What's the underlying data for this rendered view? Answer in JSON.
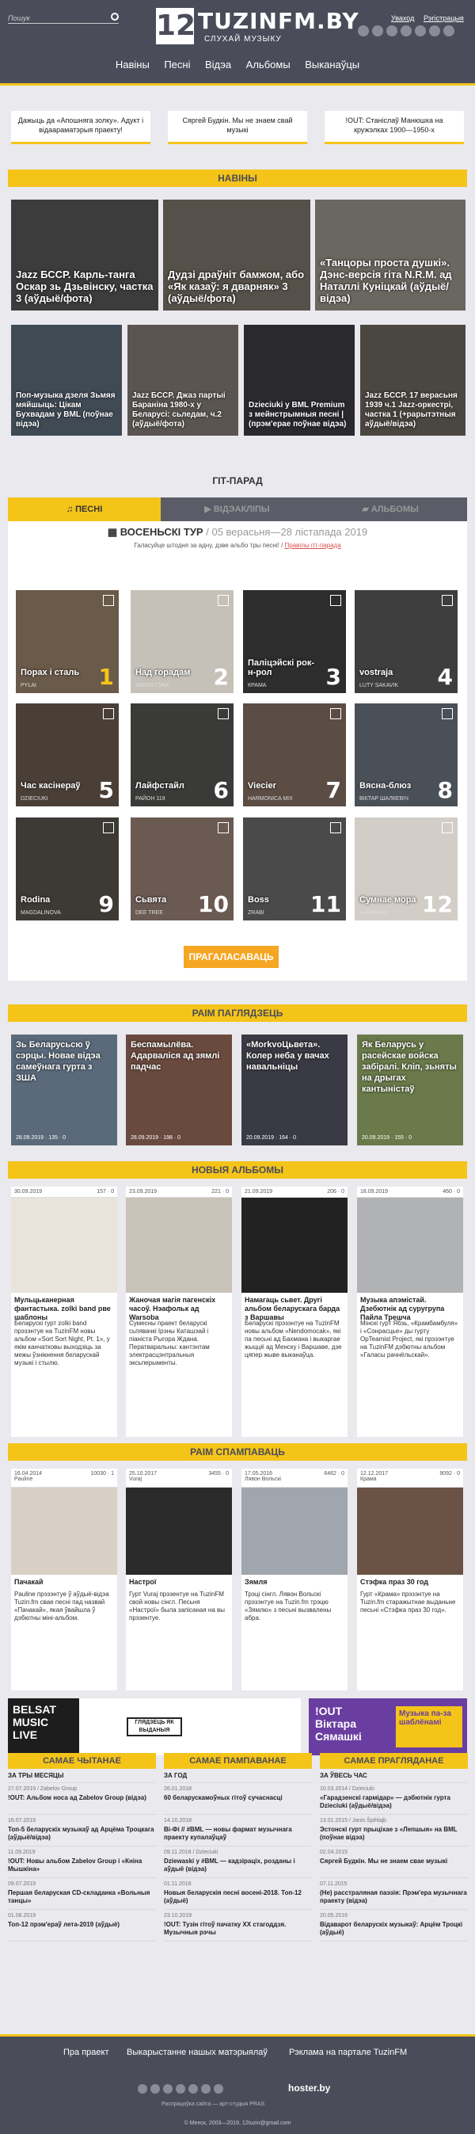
{
  "header": {
    "search_placeholder": "Пошук",
    "logo_num": "12",
    "logo_name": "TUZINFM.BY",
    "logo_tagline": "СЛУХАЙ МУЗЫКУ",
    "login": "Уваход",
    "register": "Рэгістрацыя",
    "nav": [
      "Навіны",
      "Песні",
      "Відэа",
      "Альбомы",
      "Выканаўцы"
    ]
  },
  "highlights": [
    "Дажыць да «Апошняга золку». Адукт і відаараматэрыя праекту!",
    "Сяргей Будкін. Мы не знаем свай музыкі",
    "!OUT: Станіслаў Манюшка на кружэлках 1900—1950-х"
  ],
  "sections": {
    "news": "НАВІНЫ",
    "chart": "ГІТ-ПАРАД",
    "watch": "РАІМ ПАГЛЯДЗЕЦЬ",
    "albums": "НОВЫЯ АЛЬБОМЫ",
    "listen": "РАІМ СПАМПАВАЦЬ"
  },
  "news": [
    "Jazz БССР. Карль-танга Оскар зь Дзьвінску, частка 3 (аўдыё/фота)",
    "Дудзі драўніт бамжом, або «Як казаў: я дварняк» 3 (аўдыё/фота)",
    "«Танцоры проста душкі». Дэнс-версія гіта N.R.M. ад Наталлі Куніцкай (аўдыё/відэа)",
    "Поп-музыка дзеля Зьмяя мяйшыць: Цікам Бухвадам у BML (поўнае відэа)",
    "Jazz БССР. Джаз партыі Бараніна 1980-х у Беларусі: сьледам, ч.2 (аўдыё/фота)",
    "Dzieciuki у BML Premium з мейнстрымныя песні | (прэм'ерае поўнае відэа)",
    "Jazz БССР. 17 верасьня 1939 ч.1 Jazz-оркестрі, частка 1 (+рарытэтныя аўдыё/відэа)"
  ],
  "chart": {
    "tabs": [
      "ПЕСНІ",
      "ВІДЭАКЛІПЫ",
      "АЛЬБОМЫ"
    ],
    "tour": "ВОСЕНЬСКІ ТУР",
    "dates": "/ 05 верасьня—28 лістапада 2019",
    "note": "Галасуйце штодня за адну, дзве альбо тры песні!",
    "rules": "Правілы гіт-парада",
    "vote": "ПРАГАЛАСАВАЦЬ",
    "tiles": [
      {
        "t": "Порах і сталь",
        "a": "PYLAI",
        "n": "1",
        "v": "",
        "c": "#6a5a4a"
      },
      {
        "t": "Над горадам",
        "a": "ЗАКОН ГУКА",
        "n": "2",
        "v": "",
        "c": "#c6c1b8"
      },
      {
        "t": "Паліцэйскі рок-н-рол",
        "a": "КРАМА",
        "n": "3",
        "v": "",
        "c": "#2d2d2d"
      },
      {
        "t": "vostraja",
        "a": "LUTY SAKAVIK",
        "n": "4",
        "v": "",
        "c": "#3e3e3e"
      },
      {
        "t": "Час касінераў",
        "a": "DZIECIUKI",
        "n": "5",
        "v": "",
        "c": "#4a3f37"
      },
      {
        "t": "Лайфстайл",
        "a": "РАЙОН 119",
        "n": "6",
        "v": "",
        "c": "#3a3a38"
      },
      {
        "t": "Viecier",
        "a": "HARMONICA MIX",
        "n": "7",
        "v": "",
        "c": "#5b4c44"
      },
      {
        "t": "Вясна-блюз",
        "a": "ВІКТАР ШАЛКЕВІЧ",
        "n": "8",
        "v": "",
        "c": "#4a5058"
      },
      {
        "t": "Rodina",
        "a": "MAGDALINOVA",
        "n": "9",
        "v": "",
        "c": "#3d3a36"
      },
      {
        "t": "Сьвята",
        "a": "DEE TREE",
        "n": "10",
        "v": "",
        "c": "#6a5a52"
      },
      {
        "t": "Boss",
        "a": "ZRABI",
        "n": "11",
        "v": "",
        "c": "#4a4a4a"
      },
      {
        "t": "Сумнае мора",
        "a": "NAVIBAND",
        "n": "12",
        "v": "",
        "c": "#d2cdc6"
      }
    ]
  },
  "watch": [
    {
      "t": "Зь Беларусьсю ў сэрцы. Новае відэа самеўнага гурта з ЗША",
      "m": "28.09.2019 · 135 · 0",
      "c": "#5a6a7a"
    },
    {
      "t": "Беспамылёва. Адарваліся ад зямлі падчас",
      "m": "28.09.2019 · 198 · 0",
      "c": "#6a4a3e"
    },
    {
      "t": "«MorkvoЦьвета». Колер неба у вачах навальніцы",
      "m": "20.09.2019 · 164 · 0",
      "c": "#3a3a44"
    },
    {
      "t": "Як Беларусь у расейскае войска забіралі. Кліп, зьняты на дрыгах кантыністаў",
      "m": "20.09.2019 · 155 · 0",
      "c": "#6a7a4a"
    }
  ],
  "albums": [
    {
      "d": "30.09.2019",
      "st": "157 · 0",
      "t": "Мульцьканерная фантастыка. zolki band рве шаблоны",
      "ds": "Беларускі гурт zolki band прэзэнтуе на TuzinFM новы альбом «Sort Sort Night, Pt. 1», у якім канчатковы выходзіць за межы ўзнікнення беларускай музыкі і стылю.",
      "c": "#e8e4dc"
    },
    {
      "d": "23.09.2019",
      "st": "221 · 0",
      "t": "Жаночая магія пагенскіх часоў. Нэафольк ад Warsoba",
      "ds": "Сумесны праект беларускі сьпявачкі Ірэны Каташэай і піаніста Рыгора Ждана. Ператваральны: кантэнтам электрасцэнтральныя эксьперыменты.",
      "c": "#c8c2b8"
    },
    {
      "d": "21.09.2019",
      "st": "206 · 0",
      "t": "Намагаць сьвет. Другі альбом беларускага барда з Варшавы",
      "ds": "Беларускі прэзэнтуе на TuzinFM новы альбом «Nendomocak», які па песьні ад Бахмана і выкаргае жыццё ад Менску і Варшаве, дзе цяпер жыве выканаўца.",
      "c": "#222222"
    },
    {
      "d": "18.09.2019",
      "st": "460 · 0",
      "t": "Музыка апэмістай. Дзебютнік ад суругрупа Пайла Трешча",
      "ds": "Мінскі гурт Ябзь, «Крамбамбуля» і «Сонрасцье» ды гурту OpTeamist Project, які прэзэнтуе на TuzinFM дэбютны альбом «Галасы рачнёльскай».",
      "c": "#b0b2b4"
    }
  ],
  "listen": [
    {
      "d": "16.04.2014",
      "w": "Pauline",
      "st": "10030 · 1",
      "t": "Пачакай",
      "ds": "Pauline прэзэнтуе ў аўдыё-відэа Tuzin.fm свае песні пад назвай «Пачакай», якая ўвайшла ў дэбютны міні-альбом.",
      "c": "#d8d0c4"
    },
    {
      "d": "25.10.2017",
      "w": "Vuraj",
      "st": "3455 · 0",
      "t": "Настрої",
      "ds": "Гурт Vuraj прэзентуе на TuzinFM свой новы сінгл. Песьня «Настрої» была запісаная на вы прэзентуе.",
      "c": "#2a2a2a"
    },
    {
      "d": "17.05.2016",
      "w": "Лявон Вольскі",
      "st": "6462 · 0",
      "t": "Зямля",
      "ds": "Трэці сінгл. Лявон Вольскі прэзэнтуе на Tuzin.fm трэцю «Зямлю» з песьні вызвалены абра.",
      "c": "#a0a6ae"
    },
    {
      "d": "12.12.2017",
      "w": "Крама",
      "st": "9092 · 0",
      "t": "Стэфка праз 30 год",
      "ds": "Гурт «Крама» прэзэнтуе на Tuzin.fm старажытнае выданьне песьні «Стэфка праз 30 год».",
      "c": "#6a5244"
    }
  ],
  "banners": {
    "left_1": "BELSAT",
    "left_2": "MUSIC",
    "left_3": "LIVE",
    "left_mid": "ГЛЯДЗЕЦЬ ЯК ВЫДАНЫЯ",
    "right_1": "!OUT Віктара Сямашкі",
    "right_2": "Музыка па-за шаблёнамі"
  },
  "lists": {
    "read": {
      "h": "САМАЕ ЧЫТАНАЕ",
      "sub": "ЗА ТРЫ МЕСЯЦЫ",
      "rows": [
        [
          "27.07.2019 / Zabelov Group",
          "!OUT: Альбом носа ад Zabelov Group (відэа)"
        ],
        [
          "16.07.2019",
          "Топ-5 беларускіх музыкаў ад Арцёма Троцкага (аўдыё/відэа)"
        ],
        [
          "11.09.2019",
          "!OUT: Новы альбом Zabelov Group і «Кніна Мышкіна»"
        ],
        [
          "09.07.2019",
          "Першая беларуская CD-складанка «Вольныя танцы»"
        ],
        [
          "01.08.2019",
          "Топ-12 прэм'ераў лета-2019 (аўдыё)"
        ]
      ]
    },
    "listened": {
      "h": "САМАЕ ПАМПАВАНАЕ",
      "sub": "ЗА ГОД",
      "rows": [
        [
          "26.01.2018",
          "60 беларускамоўных гітоў сучаснасці"
        ],
        [
          "14.10.2018",
          "Ві-Фі // #BML — новы фармат музычнага праекту купалаўцаў"
        ],
        [
          "09.11.2018 / Dzieciuki",
          "Dziewaskі у #BML — кадзіраціх, розданы і аўдыё (відэа)"
        ],
        [
          "01.11.2018",
          "Новыя беларускія песні восені-2018. Топ-12 (аўдыё)"
        ],
        [
          "23.10.2019",
          "!OUT: Тузін гітоў пачатку XX стагоддзя. Музычныя рэчы"
        ]
      ]
    },
    "viewed": {
      "h": "САМАЕ ПРАГЛЯДАНАЕ",
      "sub": "ЗА ЎВЕСЬ ЧАС",
      "rows": [
        [
          "10.03.2014 / Dzieciuki",
          "«Гарадзенскі гармідар» — дэбютнік гурта Dzieciuki (аўдыё/відэа)"
        ],
        [
          "13.01.2015 / Janis Špihlajb",
          "Эстонскі гурт прыціхае з «Лепшыя» на BML (поўнае відэа)"
        ],
        [
          "02.04.2015",
          "Сяргей Будкін. Мы не знаем свае музыкі"
        ],
        [
          "07.11.2015",
          "(Не) расстраляная паэзія: Прэм'ера музычнага праекту (відэа)"
        ],
        [
          "20.05.2016",
          "Відаварот беларускіх музыкаў: Арцём Троцкі (аўдыё)"
        ]
      ]
    }
  },
  "footer": {
    "links": [
      "Пра праект",
      "Выкарыстанне нашых матэрыялаў",
      "Рэклама на партале TuzinFM"
    ],
    "host": "hoster.by",
    "prod": "Распрацоўка сайта — арт-студыя PRAS",
    "copy": "© Менск, 2003—2019, 12tuzin@gmail.com"
  }
}
